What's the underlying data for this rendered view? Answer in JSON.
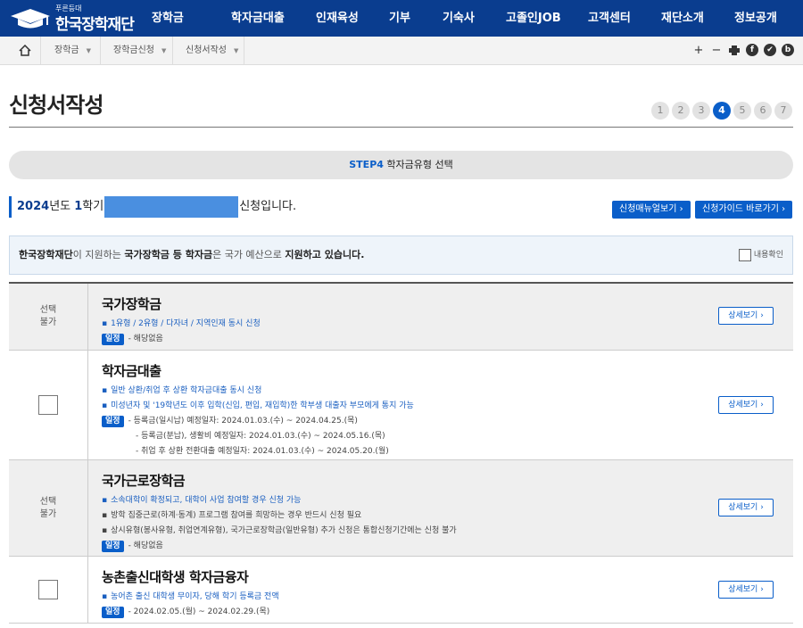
{
  "brand": {
    "slogan": "푸른등대",
    "name": "한국장학재단"
  },
  "nav": [
    "장학금",
    "학자금대출",
    "인재육성",
    "기부",
    "기숙사",
    "고졸인JOB",
    "고객센터",
    "재단소개",
    "정보공개"
  ],
  "breadcrumb": [
    "장학금",
    "장학금신청",
    "신청서작성"
  ],
  "page_title": "신청서작성",
  "steps": {
    "items": [
      "1",
      "2",
      "3",
      "4",
      "5",
      "6",
      "7"
    ],
    "current": 4
  },
  "step_bar": {
    "key": "STEP4",
    "label": "학자금유형 선택"
  },
  "apply": {
    "year": "2024",
    "year_suffix": "년도",
    "term": "1",
    "term_suffix": "학기",
    "suffix": "신청입니다."
  },
  "buttons": {
    "manual": "신청매뉴얼보기",
    "guide": "신청가이드 바로가기"
  },
  "notice": {
    "org": "한국장학재단",
    "t1": "이 지원하는 ",
    "k1": "국가장학금 등 학자금",
    "t2": "은 국가 예산으로 ",
    "k2": "지원하고 있습니다.",
    "confirm": "내용확인"
  },
  "common": {
    "not_selectable": "선택\n불가",
    "detail": "상세보기",
    "schedule": "일정"
  },
  "rows": [
    {
      "title": "국가장학금",
      "blue": [
        "1유형 / 2유형 / 다자녀 / 지역인재 동시 신청"
      ],
      "dark": [],
      "schedule": [
        "해당없음"
      ]
    },
    {
      "title": "학자금대출",
      "blue": [
        "일반 상환/취업 후 상환 학자금대출 동시 신청",
        "미성년자 및 '19학년도 이후 입학(신입, 편입, 재입학)한 학부생 대출자 부모에게 통지 가능"
      ],
      "dark": [],
      "schedule": [
        "등록금(일시납) 예정일자: 2024.01.03.(수) ~ 2024.04.25.(목)",
        "등록금(분납), 생활비 예정일자: 2024.01.03.(수) ~ 2024.05.16.(목)",
        "취업 후 상환 전환대출 예정일자: 2024.01.03.(수) ~ 2024.05.20.(월)"
      ]
    },
    {
      "title": "국가근로장학금",
      "blue": [
        "소속대학이 확정되고, 대학이 사업 참여할 경우 신청 가능"
      ],
      "dark": [
        "방학 집중근로(하계·동계) 프로그램 참여를 희망하는 경우 반드시 신청 필요",
        "상시유형(봉사유형, 취업연계유형), 국가근로장학금(일반유형) 추가 신청은 통합신청기간에는 신청 불가"
      ],
      "schedule": [
        "해당없음"
      ]
    },
    {
      "title": "농촌출신대학생 학자금융자",
      "blue": [
        "농어촌 출신 대학생 무이자, 당해 학기 등록금 전액"
      ],
      "dark": [],
      "schedule": [
        "2024.02.05.(월) ~ 2024.02.29.(목)"
      ]
    }
  ]
}
